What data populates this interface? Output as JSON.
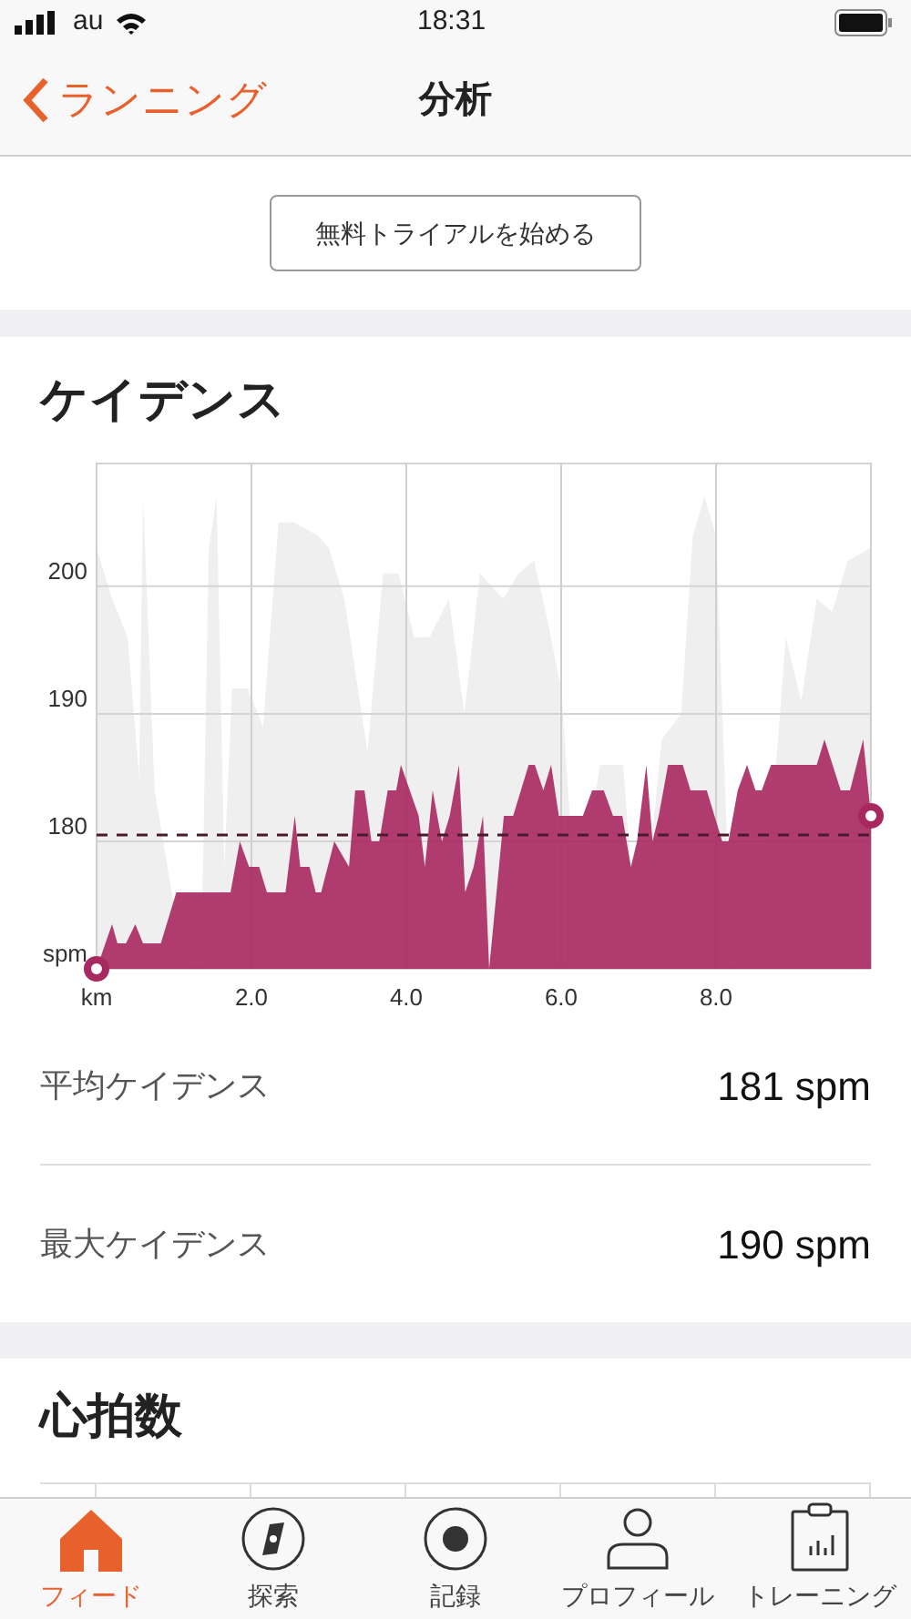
{
  "status_bar": {
    "carrier": "au",
    "time": "18:31"
  },
  "nav": {
    "back_label": "ランニング",
    "title": "分析"
  },
  "trial_button": "無料トライアルを始める",
  "cadence": {
    "title": "ケイデンス",
    "chart_data": {
      "type": "area",
      "xlim": [
        0,
        10
      ],
      "ylim": [
        170,
        209.7
      ],
      "xticks": [
        {
          "value": 0,
          "label": "km"
        },
        {
          "value": 2,
          "label": "2.0"
        },
        {
          "value": 4,
          "label": "4.0"
        },
        {
          "value": 6,
          "label": "6.0"
        },
        {
          "value": 8,
          "label": "8.0"
        }
      ],
      "grid": true,
      "yticks": [
        {
          "value": 170,
          "label": "spm"
        },
        {
          "value": 180,
          "label": "180"
        },
        {
          "value": 190,
          "label": "190"
        },
        {
          "value": 200,
          "label": "200"
        }
      ],
      "x": [
        0,
        0.2,
        0.27,
        0.38,
        0.5,
        0.6,
        0.83,
        1.03,
        1.73,
        1.85,
        1.97,
        2.1,
        2.2,
        2.44,
        2.56,
        2.63,
        2.75,
        2.83,
        2.9,
        3.07,
        3.26,
        3.34,
        3.46,
        3.55,
        3.65,
        3.76,
        3.87,
        3.93,
        4.16,
        4.24,
        4.34,
        4.46,
        4.56,
        4.68,
        4.76,
        4.87,
        4.99,
        5.07,
        5.26,
        5.38,
        5.58,
        5.66,
        5.77,
        5.87,
        5.97,
        6.28,
        6.4,
        6.55,
        6.67,
        6.79,
        6.9,
        6.98,
        7.1,
        7.18,
        7.26,
        7.38,
        7.57,
        7.67,
        7.88,
        8.08,
        8.16,
        8.28,
        8.4,
        8.51,
        8.59,
        8.71,
        9.3,
        9.4,
        9.61,
        9.73,
        9.9,
        10
      ],
      "series": [
        {
          "color": "#a82860",
          "values": [
            170,
            173.5,
            172,
            172,
            173.5,
            172,
            172,
            176,
            176,
            180,
            178,
            178,
            176,
            176,
            182,
            178,
            178,
            176,
            176,
            180,
            178,
            184,
            184,
            180,
            180,
            184,
            184,
            186,
            182,
            178,
            184,
            180,
            182,
            186,
            176,
            178,
            182,
            170,
            182,
            182,
            186,
            186,
            184,
            186,
            182,
            182,
            184,
            184,
            182,
            182,
            178,
            180,
            186,
            180,
            182,
            186,
            186,
            184,
            184,
            180,
            180,
            184,
            186,
            184,
            184,
            186,
            186,
            188,
            184,
            184,
            188,
            182
          ]
        }
      ],
      "ref_lines": [
        {
          "axis": "y",
          "value": 180.5
        }
      ]
    },
    "stats": [
      {
        "label": "平均ケイデンス",
        "value": "181 spm"
      },
      {
        "label": "最大ケイデンス",
        "value": "190 spm"
      }
    ]
  },
  "heart_rate": {
    "title": "心拍数"
  },
  "tabs": [
    {
      "label": "フィード",
      "selected": true
    },
    {
      "label": "探索",
      "selected": false
    },
    {
      "label": "記録",
      "selected": false
    },
    {
      "label": "プロフィール",
      "selected": false
    },
    {
      "label": "トレーニング",
      "selected": false
    }
  ]
}
